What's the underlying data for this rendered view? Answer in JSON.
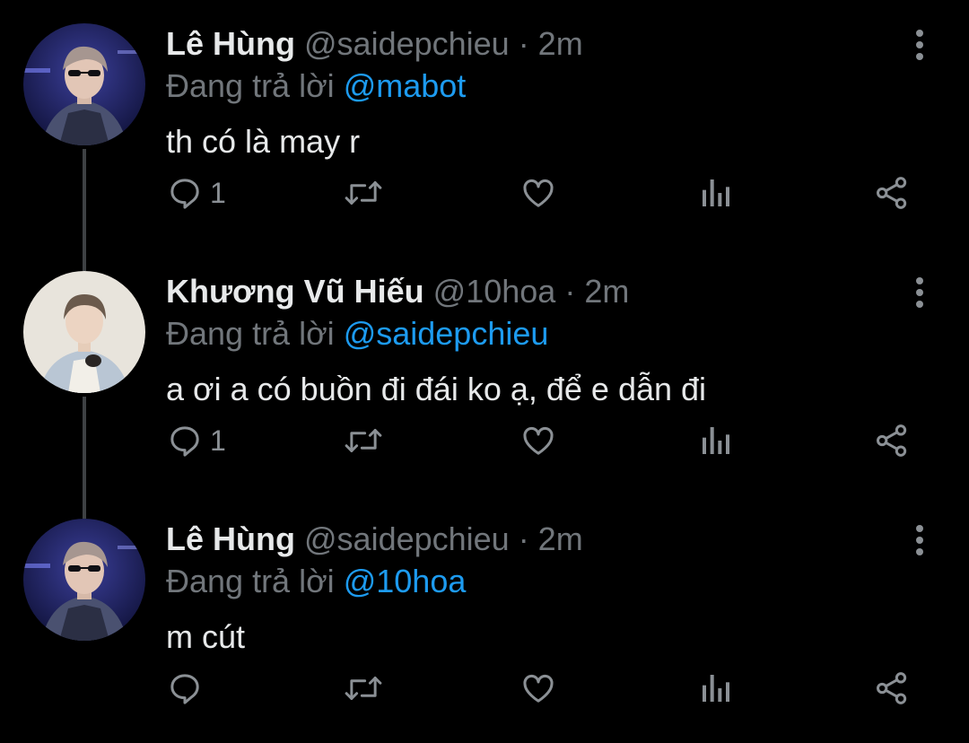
{
  "colors": {
    "background": "#000000",
    "primary_text": "#e7e9ea",
    "secondary_text": "#71767b",
    "mention": "#1d9bf0",
    "thread_line": "#3e4144"
  },
  "tweets": [
    {
      "display_name": "Lê Hùng",
      "handle_time": "@saidepchieu · 2m",
      "reply_prefix": "Đang trả lời",
      "reply_mention": "@mabot",
      "text": "th có là may r",
      "reply_count": "1",
      "avatar_icon": "user-avatar-sunglasses"
    },
    {
      "display_name": "Khương Vũ Hiếu",
      "handle_time": "@10hoa · 2m",
      "reply_prefix": "Đang trả lời",
      "reply_mention": "@saidepchieu",
      "text": "a ơi a có buồn đi đái ko ạ, để e dẫn đi",
      "reply_count": "1",
      "avatar_icon": "user-avatar-light"
    },
    {
      "display_name": "Lê Hùng",
      "handle_time": "@saidepchieu · 2m",
      "reply_prefix": "Đang trả lời",
      "reply_mention": "@10hoa",
      "text": "m cút",
      "reply_count": "",
      "avatar_icon": "user-avatar-sunglasses"
    }
  ],
  "action_icons": [
    "reply-icon",
    "retweet-icon",
    "like-icon",
    "views-icon",
    "share-icon"
  ]
}
